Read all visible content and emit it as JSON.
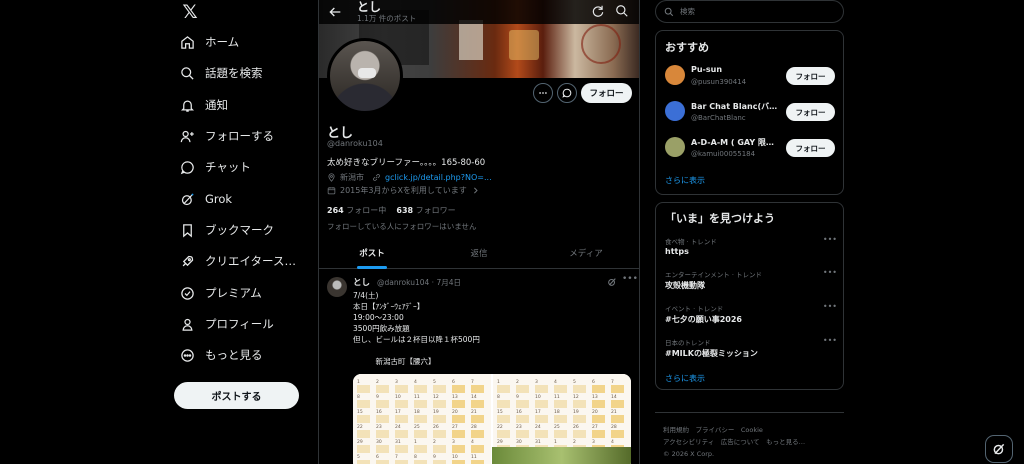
{
  "nav": {
    "logo": "𝕏",
    "items": [
      {
        "label": "ホーム",
        "icon": "home-icon"
      },
      {
        "label": "話題を検索",
        "icon": "search-icon"
      },
      {
        "label": "通知",
        "icon": "bell-icon"
      },
      {
        "label": "フォローする",
        "icon": "person-add-icon"
      },
      {
        "label": "チャット",
        "icon": "chat-icon"
      },
      {
        "label": "Grok",
        "icon": "grok-icon"
      },
      {
        "label": "ブックマーク",
        "icon": "bookmark-icon"
      },
      {
        "label": "クリエイタース…",
        "icon": "rocket-icon"
      },
      {
        "label": "プレミアム",
        "icon": "verified-icon"
      },
      {
        "label": "プロフィール",
        "icon": "person-icon"
      },
      {
        "label": "もっと見る",
        "icon": "more-circle-icon"
      }
    ],
    "post_button": "ポストする"
  },
  "header": {
    "name": "とし",
    "post_count": "1.1万 件のポスト"
  },
  "profile": {
    "name": "とし",
    "handle": "@danroku104",
    "bio": "太め好きなブリーファー。。。。165-80-60",
    "location": "新潟市",
    "link": "gclick.jp/detail.php?NO=...",
    "joined": "2015年3月からXを利用しています",
    "following_count": "264",
    "following_label": "フォロー中",
    "followers_count": "638",
    "followers_label": "フォロワー",
    "mutual_note": "フォローしている人にフォロワーはいません",
    "follow_button": "フォロー"
  },
  "tabs": [
    {
      "label": "ポスト",
      "active": true
    },
    {
      "label": "返信",
      "active": false
    },
    {
      "label": "メディア",
      "active": false
    }
  ],
  "tweet": {
    "author": "とし",
    "meta": "@danroku104 · 7月4日",
    "lines": [
      "7/4(土)",
      "本日【ｱﾝﾀﾞｰｳｪｱﾃﾞｰ】",
      "19:00〜23:00",
      "3500円飲み放題",
      "但し、ビールは２杯目以降１杯500円",
      "",
      "　　　新潟古町【腰六】"
    ]
  },
  "search": {
    "placeholder": "検索"
  },
  "suggestions": {
    "title": "おすすめ",
    "items": [
      {
        "name": "Pu-sun",
        "handle": "@pusun390414",
        "button": "フォロー",
        "color": "#d8873a"
      },
      {
        "name": "Bar Chat Blanc(バー…",
        "handle": "@BarChatBlanc",
        "button": "フォロー",
        "color": "#3b6fd6"
      },
      {
        "name": "A-D-A-M ( GAY 限定…",
        "handle": "@kamui00055184",
        "button": "フォロー",
        "color": "#9aa067"
      }
    ],
    "show_more": "さらに表示"
  },
  "trends": {
    "title": "「いま」を見つけよう",
    "items": [
      {
        "context": "食べ物 · トレンド",
        "topic": "https"
      },
      {
        "context": "エンターテインメント · トレンド",
        "topic": "攻殻機動隊"
      },
      {
        "context": "イベント · トレンド",
        "topic": "#七夕の願い事2026"
      },
      {
        "context": "日本のトレンド",
        "topic": "#MILKの極裂ミッション"
      }
    ],
    "show_more": "さらに表示"
  },
  "footer": {
    "line1": "利用規約　プライバシー　Cookie",
    "line2": "アクセシビリティ　広告について　もっと見る…",
    "line3": "© 2026 X Corp."
  },
  "colors": {
    "accent": "#1d9bf0",
    "background": "#000000",
    "border": "#2f3336",
    "muted": "#71767b"
  }
}
